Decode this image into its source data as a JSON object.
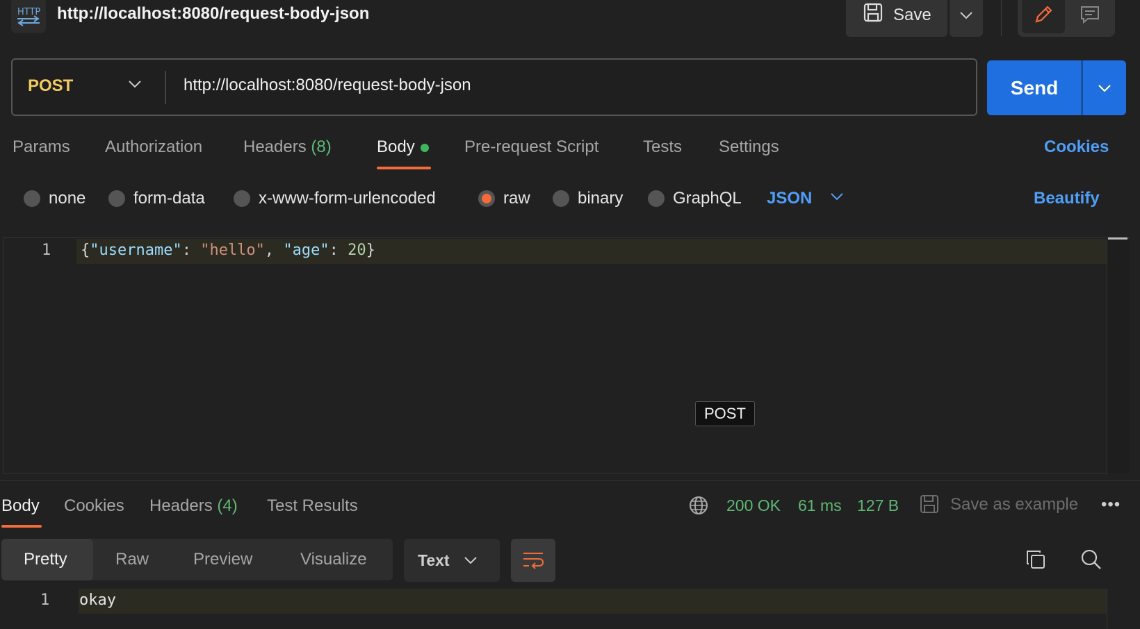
{
  "header": {
    "badge": "HTTP",
    "title": "http://localhost:8080/request-body-json",
    "save_label": "Save"
  },
  "request": {
    "method": "POST",
    "url": "http://localhost:8080/request-body-json",
    "send_label": "Send"
  },
  "request_tabs": {
    "params": "Params",
    "authorization": "Authorization",
    "headers": "Headers",
    "headers_count": "(8)",
    "body": "Body",
    "pre_request": "Pre-request Script",
    "tests": "Tests",
    "settings": "Settings",
    "cookies": "Cookies"
  },
  "body_types": {
    "none": "none",
    "form_data": "form-data",
    "urlencoded": "x-www-form-urlencoded",
    "raw": "raw",
    "binary": "binary",
    "graphql": "GraphQL",
    "format": "JSON",
    "beautify": "Beautify",
    "selected": "raw"
  },
  "editor": {
    "line_number": "1",
    "brace_open": "{",
    "key1": "\"username\"",
    "sep1": ": ",
    "val1": "\"hello\"",
    "comma": ", ",
    "key2": "\"age\"",
    "sep2": ": ",
    "val2": "20",
    "brace_close": "}"
  },
  "tooltip": "POST",
  "response": {
    "tabs": {
      "body": "Body",
      "cookies": "Cookies",
      "headers": "Headers",
      "headers_count": "(4)",
      "test_results": "Test Results"
    },
    "status": "200 OK",
    "time": "61 ms",
    "size": "127 B",
    "save_example": "Save as example",
    "more": "•••",
    "views": {
      "pretty": "Pretty",
      "raw": "Raw",
      "preview": "Preview",
      "visualize": "Visualize"
    },
    "format": "Text",
    "line_number": "1",
    "body_text": "okay"
  },
  "colors": {
    "accent_orange": "#f26b3a",
    "send_blue": "#1f6fe0",
    "link_blue": "#4f9ef7",
    "status_green": "#5fb874",
    "method_yellow": "#f2cb61"
  }
}
